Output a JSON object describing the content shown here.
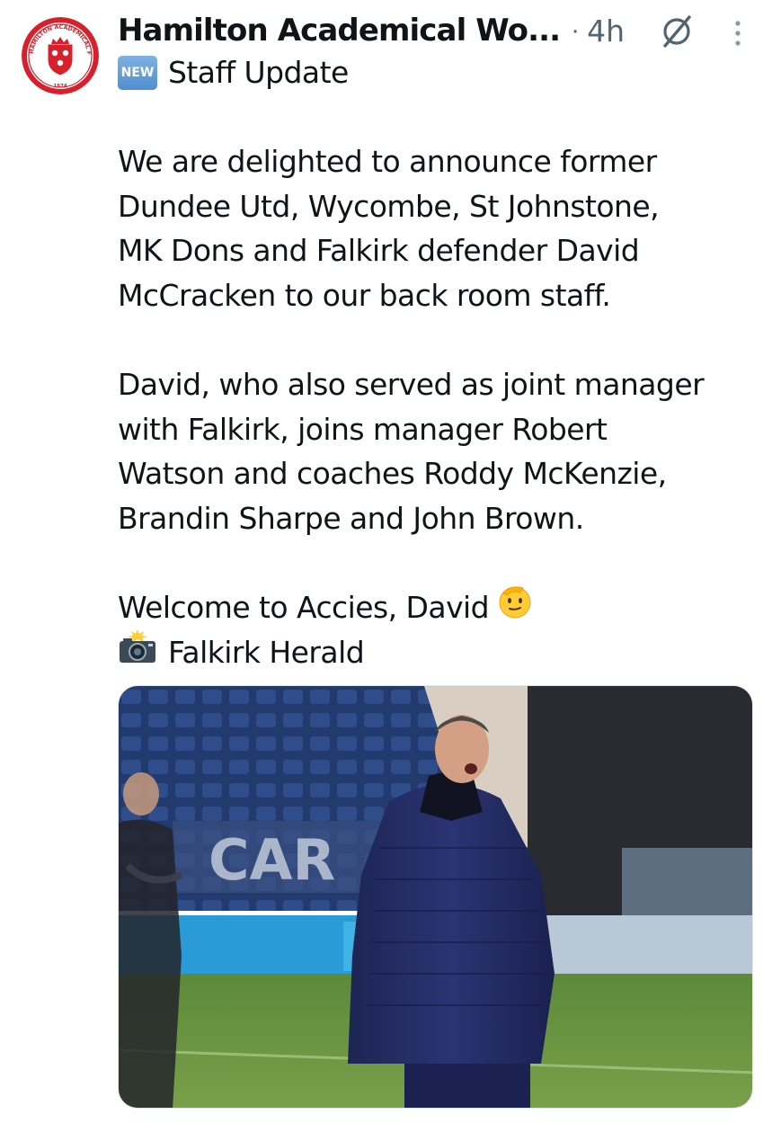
{
  "post": {
    "author_name": "Hamilton Academical Wo...",
    "separator": "·",
    "timestamp": "4h",
    "badge_text": "NEW",
    "body_lines": [
      "Staff Update",
      "",
      "We are delighted to announce former",
      "Dundee Utd, Wycombe, St Johnstone,",
      "MK Dons and Falkirk defender David",
      "McCracken to our back room staff.",
      "",
      "David, who also served as joint manager",
      "with Falkirk, joins manager Robert",
      "Watson and coaches Roddy McKenzie,",
      "Brandin Sharpe and John Brown.",
      "",
      "Welcome to Accies, David",
      "Falkirk Herald"
    ],
    "avatar": {
      "crest_text_top": "HAMILTON ACADEMICAL FOOTBALL CLUB",
      "crest_year": "1874"
    },
    "media": {
      "banner_text": "CAR"
    }
  },
  "icons": {
    "new_badge": "new-button-emoji",
    "salute": "saluting-face-emoji",
    "camera": "camera-with-flash-emoji",
    "grok": "grok-icon",
    "more": "more-options-icon"
  },
  "colors": {
    "text_primary": "#0f1419",
    "text_secondary": "#536471",
    "crest_red": "#d7202c"
  }
}
